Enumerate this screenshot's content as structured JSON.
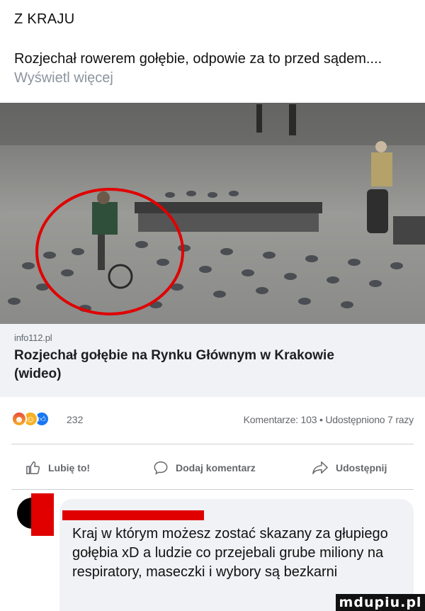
{
  "section": {
    "title": "Z KRAJU"
  },
  "post": {
    "text": "Rozjechał rowerem gołębie, odpowie za to przed sądem....",
    "see_more": "Wyświetl więcej"
  },
  "media": {
    "info_label": "i",
    "highlight_color": "#e00000"
  },
  "link_preview": {
    "domain": "info112.pl",
    "title": "Rozjechał gołębie na Rynku Głównym w Krakowie (wideo)"
  },
  "stats": {
    "reactions": [
      "angry-icon",
      "haha-icon",
      "like-icon"
    ],
    "reaction_count": "232",
    "comments_shares": "Komentarze: 103 • Udostępniono 7 razy"
  },
  "actions": {
    "like": "Lubię to!",
    "comment": "Dodaj komentarz",
    "share": "Udostępnij"
  },
  "comment": {
    "text": "Kraj w którym możesz zostać skazany za głupiego gołębia xD a ludzie co przejebali grube miliony na respiratory, maseczki i wybory są bezkarni",
    "redaction_color": "#e00000"
  },
  "watermark": {
    "text": "mdupiu.pl"
  },
  "colors": {
    "muted": "#65676b",
    "link_bg": "#f0f2f5",
    "like_blue": "#1877f2"
  }
}
